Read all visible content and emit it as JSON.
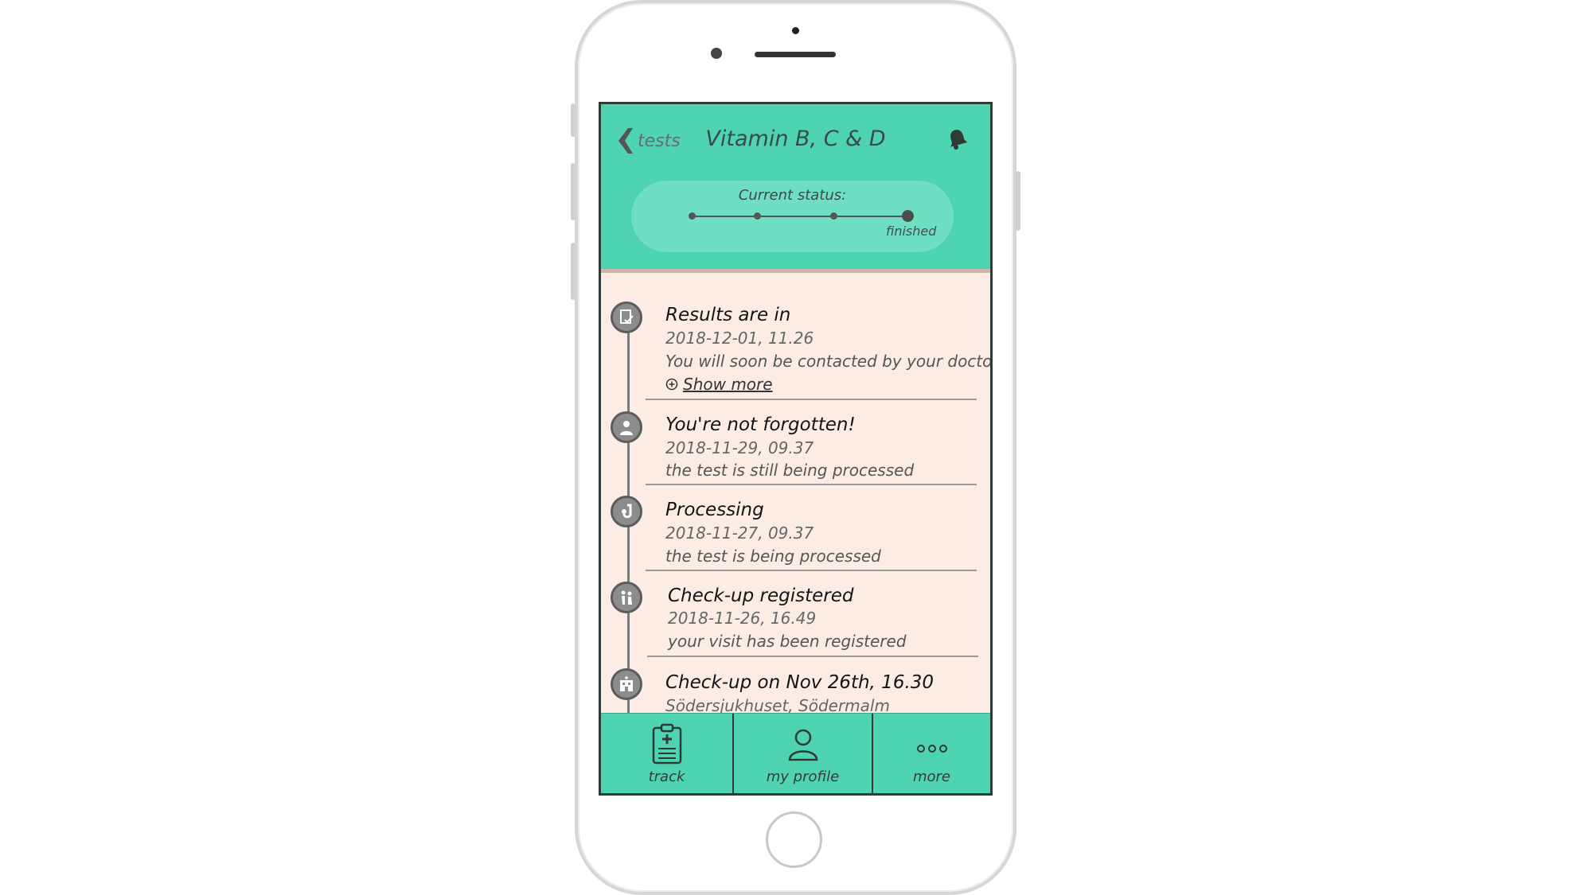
{
  "header": {
    "back_label": "tests",
    "title": "Vitamin B, C & D",
    "status_label": "Current status:",
    "status_final": "finished"
  },
  "events": [
    {
      "title": "Results are in",
      "date": "2018-12-01, 11.26",
      "description": "You will soon be contacted by your doctor",
      "show_more": "Show more",
      "icon": "document-check-icon"
    },
    {
      "title": "You're not forgotten!",
      "date": "2018-11-29, 09.37",
      "description": "the test is still being processed",
      "icon": "doctor-icon"
    },
    {
      "title": "Processing",
      "date": "2018-11-27, 09.37",
      "description": "the test is being processed",
      "icon": "processing-icon"
    },
    {
      "title": "Check-up registered",
      "date": "2018-11-26, 16.49",
      "description": "your visit has been registered",
      "icon": "checkin-icon"
    },
    {
      "title": "Check-up on Nov 26th, 16.30",
      "location": "Södersjukhuset, Södermalm",
      "icon": "hospital-icon"
    }
  ],
  "nav": {
    "track": "track",
    "profile": "my profile",
    "more": "more"
  },
  "colors": {
    "accent": "#4fd4b1",
    "pill": "#6fdfc3",
    "content_bg": "#fcece4"
  }
}
